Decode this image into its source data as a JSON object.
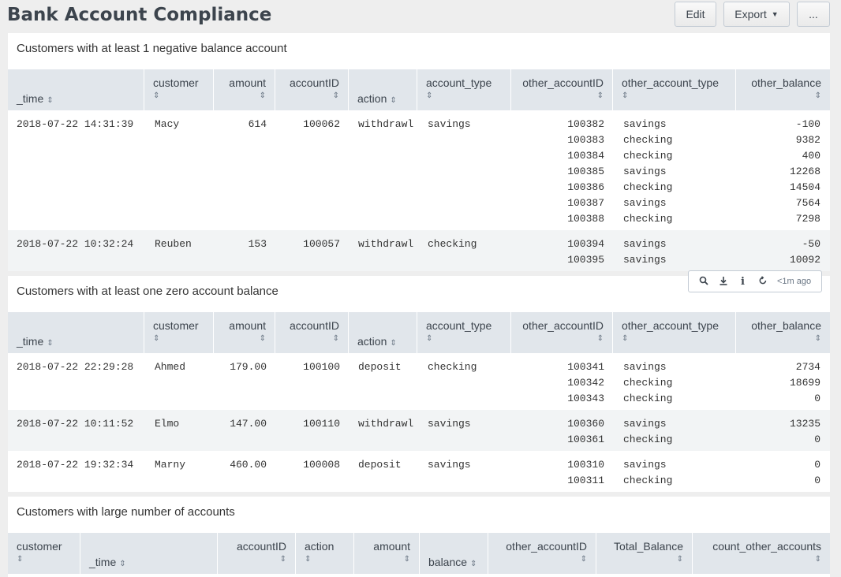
{
  "header": {
    "title": "Bank Account Compliance",
    "edit_label": "Edit",
    "export_label": "Export",
    "more_label": "..."
  },
  "panel1": {
    "title": "Customers with at least 1 negative balance account",
    "columns": [
      "_time",
      "customer",
      "amount",
      "accountID",
      "action",
      "account_type",
      "other_accountID",
      "other_account_type",
      "other_balance"
    ],
    "rows": [
      {
        "time": "2018-07-22 14:31:39",
        "customer": "Macy",
        "amount": "614",
        "accountID": "100062",
        "action": "withdrawl",
        "account_type": "savings",
        "other_accountID": [
          "100382",
          "100383",
          "100384",
          "100385",
          "100386",
          "100387",
          "100388"
        ],
        "other_account_type": [
          "savings",
          "checking",
          "checking",
          "savings",
          "checking",
          "savings",
          "checking"
        ],
        "other_balance": [
          "-100",
          "9382",
          "400",
          "12268",
          "14504",
          "7564",
          "7298"
        ]
      },
      {
        "time": "2018-07-22 10:32:24",
        "customer": "Reuben",
        "amount": "153",
        "accountID": "100057",
        "action": "withdrawl",
        "account_type": "checking",
        "other_accountID": [
          "100394",
          "100395"
        ],
        "other_account_type": [
          "savings",
          "savings"
        ],
        "other_balance": [
          "-50",
          "10092"
        ]
      }
    ]
  },
  "panel_toolbar": {
    "icons": [
      "search-icon",
      "download-icon",
      "info-icon",
      "refresh-icon"
    ],
    "time_ago": "<1m ago"
  },
  "panel2": {
    "title": "Customers with at least one zero account balance",
    "columns": [
      "_time",
      "customer",
      "amount",
      "accountID",
      "action",
      "account_type",
      "other_accountID",
      "other_account_type",
      "other_balance"
    ],
    "rows": [
      {
        "time": "2018-07-22 22:29:28",
        "customer": "Ahmed",
        "amount": "179.00",
        "accountID": "100100",
        "action": "deposit",
        "account_type": "checking",
        "other_accountID": [
          "100341",
          "100342",
          "100343"
        ],
        "other_account_type": [
          "savings",
          "checking",
          "checking"
        ],
        "other_balance": [
          "2734",
          "18699",
          "0"
        ]
      },
      {
        "time": "2018-07-22 10:11:52",
        "customer": "Elmo",
        "amount": "147.00",
        "accountID": "100110",
        "action": "withdrawl",
        "account_type": "savings",
        "other_accountID": [
          "100360",
          "100361"
        ],
        "other_account_type": [
          "savings",
          "checking"
        ],
        "other_balance": [
          "13235",
          "0"
        ]
      },
      {
        "time": "2018-07-22 19:32:34",
        "customer": "Marny",
        "amount": "460.00",
        "accountID": "100008",
        "action": "deposit",
        "account_type": "savings",
        "other_accountID": [
          "100310",
          "100311"
        ],
        "other_account_type": [
          "savings",
          "checking"
        ],
        "other_balance": [
          "0",
          "0"
        ]
      }
    ]
  },
  "panel3": {
    "title": "Customers with large number of accounts",
    "columns": [
      "customer",
      "_time",
      "accountID",
      "action",
      "amount",
      "balance",
      "other_accountID",
      "Total_Balance",
      "count_other_accounts"
    ]
  },
  "sort_glyph": "⇕"
}
